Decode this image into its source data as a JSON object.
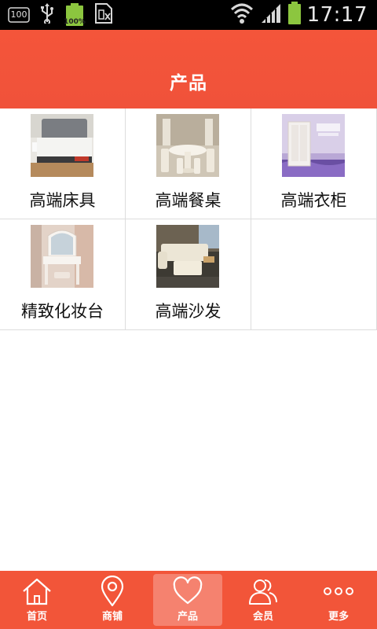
{
  "status_bar": {
    "notification_badge": "100",
    "battery_small_text": "100%",
    "time": "17:17"
  },
  "header": {
    "title": "产品"
  },
  "products": [
    {
      "label": "高端床具",
      "image": "bed"
    },
    {
      "label": "高端餐桌",
      "image": "dining-table"
    },
    {
      "label": "高端衣柜",
      "image": "wardrobe"
    },
    {
      "label": "精致化妆台",
      "image": "dressing-table"
    },
    {
      "label": "高端沙发",
      "image": "sofa"
    }
  ],
  "bottom_nav": {
    "items": [
      {
        "label": "首页",
        "icon": "home-icon",
        "active": false
      },
      {
        "label": "商铺",
        "icon": "location-pin-icon",
        "active": false
      },
      {
        "label": "产品",
        "icon": "heart-icon",
        "active": true
      },
      {
        "label": "会员",
        "icon": "users-icon",
        "active": false
      },
      {
        "label": "更多",
        "icon": "more-dots-icon",
        "active": false
      }
    ]
  },
  "colors": {
    "brand": "#f25539",
    "nav_active": "#f5826f",
    "statusbar_bg": "#000000",
    "battery_green": "#8cc63f"
  }
}
